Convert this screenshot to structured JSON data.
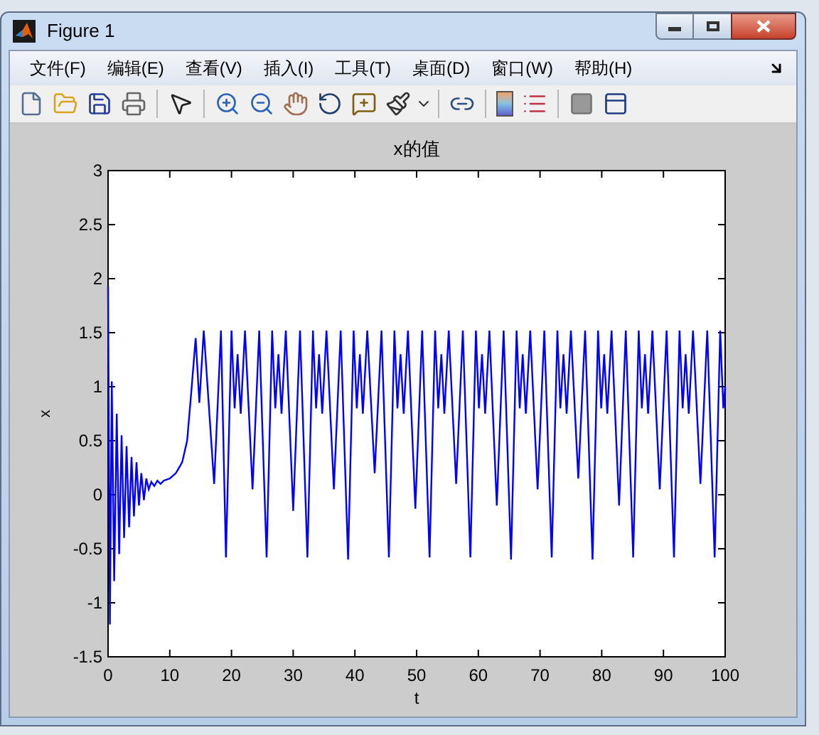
{
  "window": {
    "title": "Figure 1"
  },
  "menu": [
    "文件(F)",
    "编辑(E)",
    "查看(V)",
    "插入(I)",
    "工具(T)",
    "桌面(D)",
    "窗口(W)",
    "帮助(H)"
  ],
  "toolbar": [
    {
      "kind": "new"
    },
    {
      "kind": "open"
    },
    {
      "kind": "save"
    },
    {
      "kind": "print"
    },
    {
      "kind": "sep"
    },
    {
      "kind": "pointer"
    },
    {
      "kind": "sep"
    },
    {
      "kind": "zoom_in"
    },
    {
      "kind": "zoom_out"
    },
    {
      "kind": "pan"
    },
    {
      "kind": "rotate"
    },
    {
      "kind": "cursor"
    },
    {
      "kind": "brush"
    },
    {
      "kind": "sep"
    },
    {
      "kind": "link"
    },
    {
      "kind": "sep"
    },
    {
      "kind": "colorbar"
    },
    {
      "kind": "legend"
    },
    {
      "kind": "sep"
    },
    {
      "kind": "hide_tools"
    },
    {
      "kind": "show_tools"
    }
  ],
  "chart_data": {
    "type": "line",
    "title": "x的值",
    "xlabel": "t",
    "ylabel": "x",
    "xlim": [
      0,
      100
    ],
    "ylim": [
      -1.5,
      3
    ],
    "xticks": [
      0,
      10,
      20,
      30,
      40,
      50,
      60,
      70,
      80,
      90,
      100
    ],
    "yticks": [
      -1.5,
      -1,
      -0.5,
      0,
      0.5,
      1,
      1.5,
      2,
      2.5,
      3
    ],
    "x": [
      0,
      0.3,
      0.6,
      1,
      1.4,
      1.8,
      2.2,
      2.6,
      3,
      3.4,
      3.8,
      4.2,
      4.6,
      5,
      5.4,
      5.8,
      6.2,
      6.6,
      7,
      7.5,
      8,
      8.5,
      9,
      10,
      11,
      12,
      12.8,
      13.4,
      14.2,
      14.8,
      15.5,
      17.2,
      18.3,
      19.1,
      20,
      20.5,
      21,
      21.5,
      22.2,
      23.4,
      24.5,
      25.7,
      26.6,
      27.1,
      27.6,
      28.1,
      28.8,
      30,
      31.1,
      32.3,
      33.2,
      33.7,
      34.2,
      34.7,
      35.4,
      36.6,
      37.7,
      38.9,
      39.8,
      40.3,
      40.8,
      41.3,
      42,
      43.2,
      44.3,
      45.5,
      46.4,
      46.9,
      47.4,
      47.9,
      48.6,
      49.8,
      50.9,
      52.1,
      53,
      53.5,
      54,
      54.5,
      55.2,
      56.4,
      57.5,
      58.7,
      59.6,
      60.1,
      60.6,
      61.1,
      61.8,
      63,
      64.1,
      65.3,
      66.2,
      66.7,
      67.2,
      67.7,
      68.4,
      69.6,
      70.7,
      71.9,
      72.8,
      73.3,
      73.8,
      74.3,
      75,
      76.2,
      77.3,
      78.5,
      79.4,
      79.9,
      80.4,
      80.9,
      81.6,
      82.8,
      83.9,
      85.1,
      86,
      86.5,
      87,
      87.5,
      88.2,
      89.4,
      90.5,
      91.7,
      92.6,
      93.1,
      93.6,
      94.1,
      94.8,
      96,
      97.1,
      98.3,
      99.2,
      99.7,
      100
    ],
    "series": [
      {
        "color": "#0000ff",
        "values": [
          1.93,
          -1.2,
          1.05,
          -0.8,
          0.75,
          -0.55,
          0.55,
          -0.4,
          0.45,
          -0.3,
          0.35,
          -0.2,
          0.3,
          -0.1,
          0.2,
          -0.05,
          0.15,
          0.05,
          0.12,
          0.08,
          0.13,
          0.1,
          0.13,
          0.15,
          0.2,
          0.3,
          0.5,
          0.9,
          1.45,
          0.85,
          1.52,
          0.1,
          1.52,
          -0.58,
          1.52,
          0.8,
          1.3,
          0.75,
          1.52,
          0.05,
          1.52,
          -0.58,
          1.52,
          0.8,
          1.3,
          0.75,
          1.52,
          -0.15,
          1.52,
          -0.58,
          1.52,
          0.8,
          1.3,
          0.75,
          1.52,
          0.05,
          1.52,
          -0.6,
          1.52,
          0.8,
          1.3,
          0.75,
          1.52,
          0.2,
          1.52,
          -0.58,
          1.52,
          0.8,
          1.3,
          0.75,
          1.52,
          -0.13,
          1.52,
          -0.58,
          1.52,
          0.8,
          1.3,
          0.75,
          1.52,
          0.1,
          1.52,
          -0.58,
          1.52,
          0.8,
          1.3,
          0.75,
          1.52,
          -0.1,
          1.52,
          -0.6,
          1.52,
          0.8,
          1.3,
          0.75,
          1.52,
          0.05,
          1.52,
          -0.58,
          1.52,
          0.8,
          1.3,
          0.75,
          1.52,
          0.15,
          1.52,
          -0.6,
          1.52,
          0.8,
          1.3,
          0.75,
          1.52,
          -0.1,
          1.52,
          -0.58,
          1.52,
          0.8,
          1.3,
          0.75,
          1.52,
          0.05,
          1.52,
          -0.58,
          1.52,
          0.8,
          1.3,
          0.75,
          1.52,
          0.1,
          1.52,
          -0.58,
          1.52,
          0.8,
          1.0
        ]
      }
    ]
  }
}
